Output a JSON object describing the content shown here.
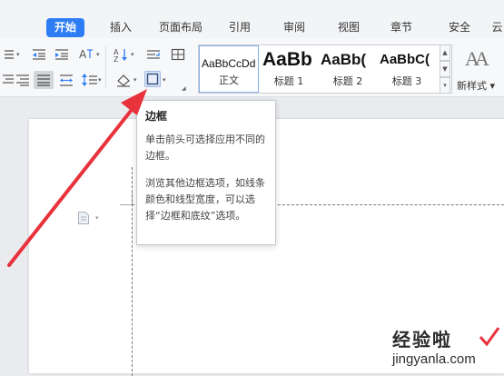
{
  "tabs": [
    {
      "label": "开始",
      "active": true
    },
    {
      "label": "插入"
    },
    {
      "label": "页面布局"
    },
    {
      "label": "引用"
    },
    {
      "label": "审阅"
    },
    {
      "label": "视图"
    },
    {
      "label": "章节"
    },
    {
      "label": "安全"
    },
    {
      "label": "云"
    }
  ],
  "styles": {
    "items": [
      {
        "sample": "AaBbCcDd",
        "label": "正文",
        "selected": true
      },
      {
        "sample": "AaBb",
        "label": "标题 1"
      },
      {
        "sample": "AaBb(",
        "label": "标题 2"
      },
      {
        "sample": "AaBbC(",
        "label": "标题 3"
      }
    ],
    "new_style": "新样式",
    "new_style_icon_text": "AA"
  },
  "tooltip": {
    "title": "边框",
    "para1": "单击前头可选择应用不同的边框。",
    "para2": "浏览其他边框选项，如线条颜色和线型宽度，可以选择“边框和底纹”选项。"
  },
  "watermark": {
    "cn": "经验啦",
    "en": "jingyanla.com",
    "check": "√"
  },
  "colors": {
    "accent": "#2e7df6",
    "arrow": "#e8323c"
  }
}
